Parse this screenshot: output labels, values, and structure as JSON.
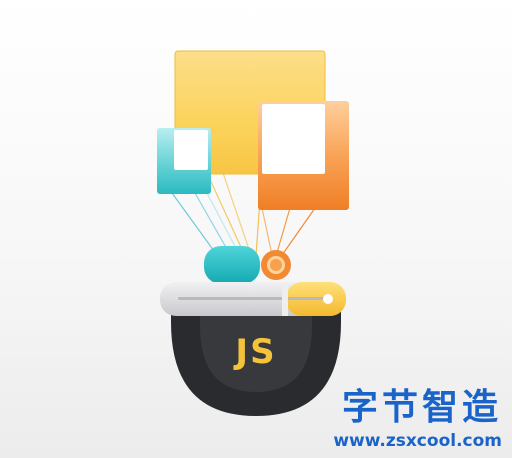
{
  "logo": {
    "text": "JS"
  },
  "watermark": {
    "title": "字节智造",
    "url": "www.zsxcool.com"
  },
  "colors": {
    "brand_blue": "#1a63c9",
    "js_yellow": "#f5c33b",
    "panel_yellow": "#fbd35b",
    "panel_orange": "#f58a2e",
    "panel_teal": "#39c2c6",
    "pill_teal": "#1fb7bf",
    "bowl_dark": "#2c2d30",
    "bar_gray": "#d6d6d9"
  },
  "icons": {
    "logo": "javascript-logo-badge"
  }
}
